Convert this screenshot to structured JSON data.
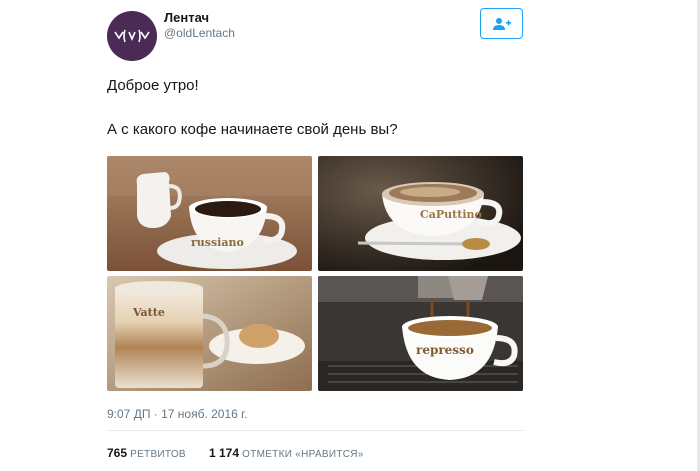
{
  "account": {
    "name": "Лентач",
    "handle": "@oldLentach"
  },
  "tweet": {
    "line1": "Доброе утро!",
    "line2": "А с какого кофе начинаете свой день вы?",
    "timestamp": "9:07 ДП · 17 нояб. 2016 г."
  },
  "photos": [
    {
      "cup_label": "russiano",
      "icon": "coffee-photo"
    },
    {
      "cup_label": "CaPuttino",
      "icon": "coffee-photo"
    },
    {
      "cup_label": "Vatte",
      "icon": "coffee-photo"
    },
    {
      "cup_label": "represso",
      "icon": "coffee-photo"
    }
  ],
  "stats": {
    "retweets_count": "765",
    "retweets_label": "РЕТВИТОВ",
    "likes_count": "1 174",
    "likes_label": "ОТМЕТКИ «НРАВИТСЯ»"
  },
  "colors": {
    "accent": "#1da1f2",
    "avatar_bg": "#4b2a55",
    "secondary_text": "#657786"
  }
}
